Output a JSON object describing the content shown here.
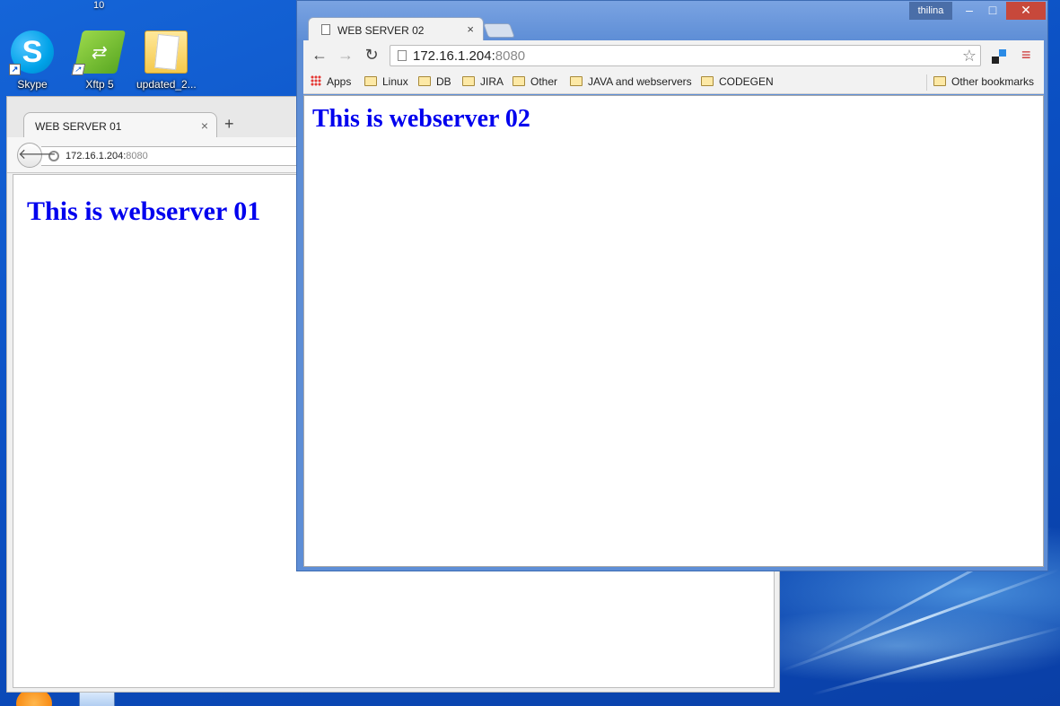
{
  "desktop": {
    "top_label": "10",
    "icons": [
      {
        "label": "Skype",
        "icon": "skype-icon"
      },
      {
        "label": "Xftp 5",
        "icon": "xftp-icon"
      },
      {
        "label": "updated_2...",
        "icon": "folder-icon"
      }
    ]
  },
  "window1": {
    "tab_title": "WEB SERVER 01",
    "tab_close": "×",
    "new_tab": "+",
    "back_glyph": "🡐",
    "url_host": "172.16.1.204:",
    "url_port": "8080",
    "heading": "This is webserver 01"
  },
  "window2": {
    "profile_name": "thilina",
    "tab_title": "WEB SERVER 02",
    "tab_close": "×",
    "url_host": "172.16.1.204:",
    "url_port": "8080",
    "bookmarks": [
      {
        "label": "Apps",
        "kind": "apps"
      },
      {
        "label": "Linux",
        "kind": "folder"
      },
      {
        "label": "DB",
        "kind": "folder"
      },
      {
        "label": "JIRA",
        "kind": "folder"
      },
      {
        "label": "Other",
        "kind": "folder"
      },
      {
        "label": "JAVA and webservers",
        "kind": "folder"
      },
      {
        "label": "CODEGEN",
        "kind": "folder"
      }
    ],
    "other_bookmarks": "Other bookmarks",
    "heading": "This is webserver 02",
    "colors": {
      "caption": "#5e8ed6",
      "close": "#c7483b",
      "link_heading": "#0000ee"
    }
  }
}
